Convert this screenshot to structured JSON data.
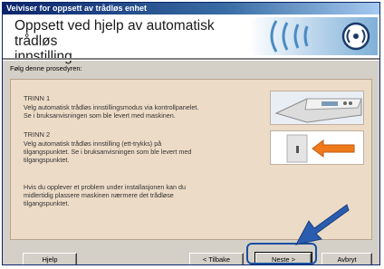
{
  "window": {
    "title": "Veiviser for oppsett av trådløs enhet"
  },
  "header": {
    "heading_line1": "Oppsett ved hjelp av automatisk trådløs",
    "heading_line2": "innstilling"
  },
  "intro": "Følg denne prosedyren:",
  "steps": [
    {
      "title": "TRINN 1",
      "lines": [
        "Velg automatisk trådløs innstillingsmodus via kontrollpanelet.",
        "Se i bruksanvisningen som ble levert med maskinen."
      ]
    },
    {
      "title": "TRINN 2",
      "lines": [
        "Velg automatisk trådløs innstilling (ett-trykks) på",
        "tilgangspunktet. Se i bruksanvisningen som ble levert med",
        "tilgangspunktet."
      ]
    }
  ],
  "note": {
    "lines": [
      "Hvis du opplever et problem under installasjonen kan du",
      "midlertidig plassere maskinen nærmere det trådløse",
      "tilgangspunktet."
    ]
  },
  "buttons": {
    "help": "Hjelp",
    "back": "< Tilbake",
    "next": "Neste >",
    "cancel": "Avbryt"
  },
  "icons": {
    "logo": "wireless-signal-icon",
    "step1_image": "printer-control-panel-icon",
    "step2_image": "access-point-button-arrow-icon",
    "pointer": "blue-arrow-icon"
  },
  "colors": {
    "titlebar": "#0a246a",
    "panel_bg": "#ecdbc6",
    "highlight": "#1a4fa0",
    "arrow": "#2a5db0",
    "arrow_orange": "#f07a1a"
  }
}
